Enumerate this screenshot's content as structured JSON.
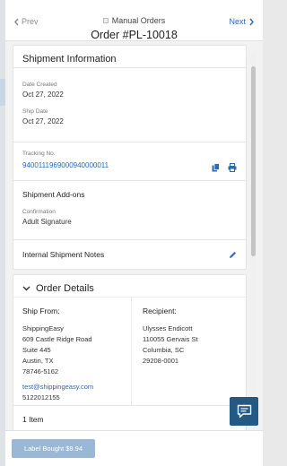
{
  "header": {
    "prev_label": "Prev",
    "next_label": "Next",
    "subtitle": "Manual Orders",
    "order_title": "Order #PL-10018"
  },
  "shipment": {
    "title": "Shipment Information",
    "date_created_label": "Date Created",
    "date_created": "Oct 27, 2022",
    "ship_date_label": "Ship Date",
    "ship_date": "Oct 27, 2022",
    "tracking_label": "Tracking No.",
    "tracking_number": "9400111969000940000011",
    "addons_title": "Shipment Add-ons",
    "confirmation_label": "Confirmation",
    "confirmation_value": "Adult Signature",
    "notes_title": "Internal Shipment Notes"
  },
  "order_details": {
    "title": "Order Details",
    "ship_from_label": "Ship From:",
    "ship_from_lines": [
      "ShippingEasy",
      "609 Castle Ridge Road",
      "Suite 445",
      "Austin, TX",
      "78746-5162"
    ],
    "ship_from_email": "test@shippingeasy.com",
    "ship_from_phone": "5122012155",
    "recipient_label": "Recipient:",
    "recipient_lines": [
      "Ulysses Endicott",
      "110055 Gervais St",
      "Columbia, SC",
      "29208-0001"
    ],
    "items_count": "1 Item"
  },
  "footer": {
    "label_button": "Label Bought $9.94"
  },
  "colors": {
    "accent": "#2a6ab5",
    "chat_button": "#225a85",
    "label_button": "#9ab8d6"
  },
  "icons": [
    "chevron-left-icon",
    "chevron-right-icon",
    "copy-icon",
    "print-icon",
    "pencil-icon",
    "chevron-down-icon",
    "chat-icon"
  ]
}
